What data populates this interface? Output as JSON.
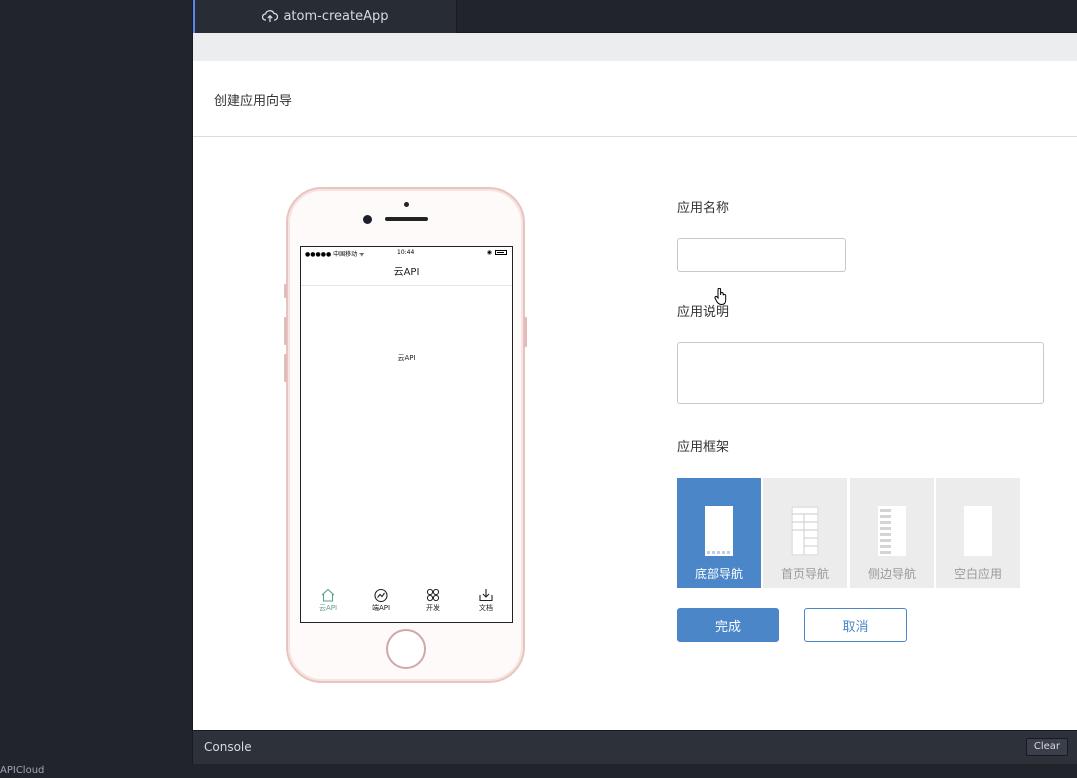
{
  "tab": {
    "title": "atom-createApp"
  },
  "wizard": {
    "title": "创建应用向导"
  },
  "phone": {
    "carrier": "●●●●● 中国移动 ᯤ",
    "time": "10:44",
    "nav_title": "云API",
    "content_text": "云API",
    "tabs": [
      {
        "label": "云API",
        "icon": "home-icon",
        "active": true
      },
      {
        "label": "端API",
        "icon": "gauge-icon",
        "active": false
      },
      {
        "label": "开发",
        "icon": "grid-icon",
        "active": false
      },
      {
        "label": "文档",
        "icon": "download-icon",
        "active": false
      }
    ],
    "active_color": "#5a9f8a"
  },
  "form": {
    "name_label": "应用名称",
    "name_value": "",
    "desc_label": "应用说明",
    "desc_value": "",
    "frame_label": "应用框架",
    "frames": [
      {
        "label": "底部导航",
        "selected": true
      },
      {
        "label": "首页导航",
        "selected": false
      },
      {
        "label": "侧边导航",
        "selected": false
      },
      {
        "label": "空白应用",
        "selected": false
      }
    ],
    "finish_label": "完成",
    "cancel_label": "取消"
  },
  "colors": {
    "accent": "#4a86c8",
    "tab_indicator": "#568af2"
  },
  "console": {
    "label": "Console",
    "clear_label": "Clear"
  },
  "status_bar": {
    "text": "APICloud"
  }
}
